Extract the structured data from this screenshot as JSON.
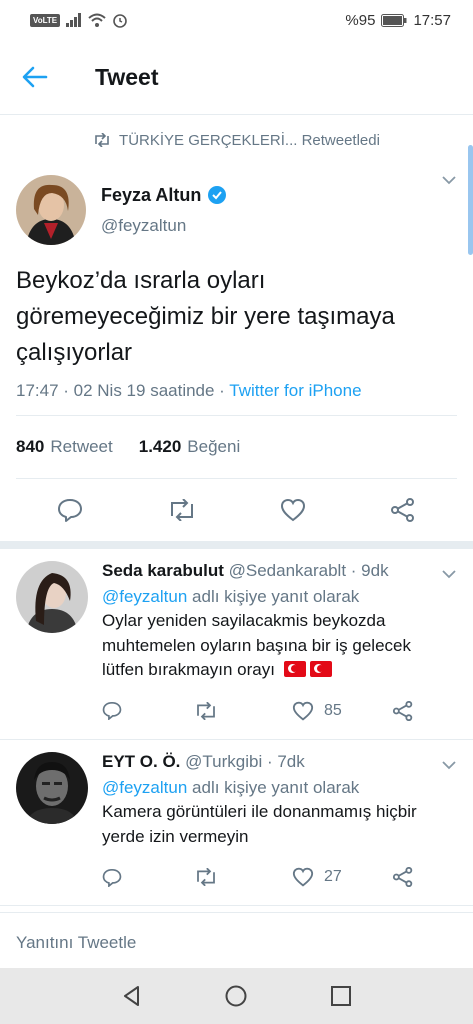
{
  "status_bar": {
    "volte": "VoLTE",
    "battery": "%95",
    "time": "17:57"
  },
  "app_bar": {
    "title": "Tweet"
  },
  "retweet_context": {
    "text": "TÜRKİYE GERÇEKLERİ... Retweetledi"
  },
  "tweet": {
    "author_name": "Feyza Altun",
    "author_handle": "@feyzaltun",
    "text": "Beykoz’da ısrarla oyları göremeyeceğimiz bir yere taşımaya çalışıyorlar",
    "timestamp": "17:47 · 02 Nis 19 saatinde · ",
    "source": "Twitter for iPhone",
    "retweet_count": "840",
    "retweet_label": "Retweet",
    "like_count": "1.420",
    "like_label": "Beğeni"
  },
  "replies": [
    {
      "name": "Seda karabulut",
      "handle": "@Sedankarablt",
      "time": " · 9dk",
      "replying_mention": "@feyzaltun",
      "replying_suffix": " adlı kişiye yanıt olarak",
      "text": "Oylar yeniden sayilacakmis beykozda muhtemelen oyların başına bir iş gelecek lütfen bırakmayın orayı",
      "like_count": "85"
    },
    {
      "name": "EYT O. Ö.",
      "handle": "@Turkgibi",
      "time": " · 7dk",
      "replying_mention": "@feyzaltun",
      "replying_suffix": " adlı kişiye yanıt olarak",
      "text": "Kamera görüntüleri ile donanmamış hiçbir yerde izin vermeyin",
      "like_count": "27"
    }
  ],
  "compose": {
    "placeholder": "Yanıtını Tweetle"
  },
  "icons": {
    "back": "arrow-left-icon",
    "verified": "verified-badge-icon",
    "reply": "reply-icon",
    "retweet": "retweet-icon",
    "like": "heart-icon",
    "share": "share-icon",
    "caret": "chevron-down-icon"
  },
  "colors": {
    "accent": "#1da1f2",
    "muted": "#657786",
    "text": "#14171a"
  }
}
